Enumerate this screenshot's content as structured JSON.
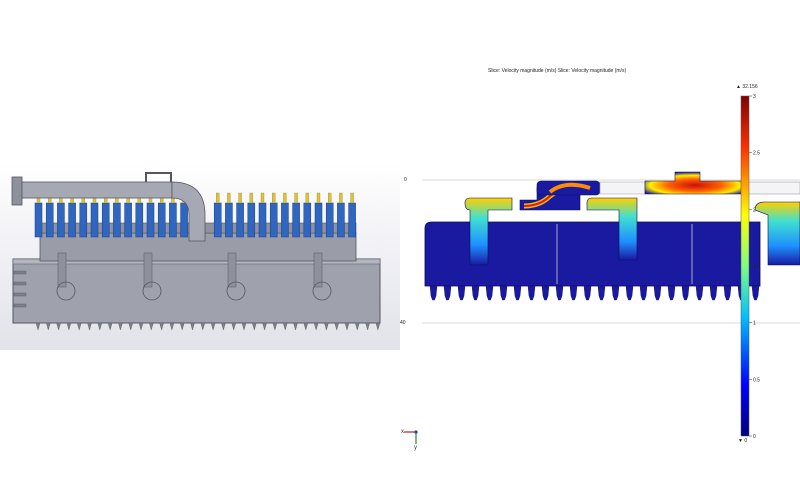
{
  "plot": {
    "title": "Slice: Velocity magnitude (m/s)  Slice: Velocity magnitude (m/s)",
    "y_tick_top": "0",
    "y_tick_bottom": "40",
    "triad_x": "x",
    "triad_y": "y"
  },
  "colorbar": {
    "max_label": "▲ 32.156",
    "min_label": "▼ 0",
    "ticks": [
      "3",
      "2.5",
      "2",
      "1.5",
      "1",
      "0.5",
      "0"
    ]
  },
  "colors": {
    "model_gray": "#9fa1ad",
    "model_edge": "#55575f",
    "nozzle_blue": "#2f66c2",
    "nozzle_tip": "#d9c53a",
    "field_low": "#1a1aa0",
    "field_high": "#d01a10"
  }
}
